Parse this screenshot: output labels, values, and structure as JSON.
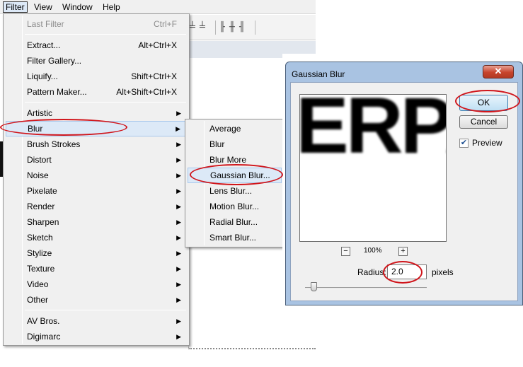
{
  "menubar": {
    "items": [
      "Filter",
      "View",
      "Window",
      "Help"
    ]
  },
  "filter_menu": {
    "last_filter": {
      "label": "Last Filter",
      "shortcut": "Ctrl+F"
    },
    "group1": [
      {
        "label": "Extract...",
        "shortcut": "Alt+Ctrl+X"
      },
      {
        "label": "Filter Gallery...",
        "shortcut": ""
      },
      {
        "label": "Liquify...",
        "shortcut": "Shift+Ctrl+X"
      },
      {
        "label": "Pattern Maker...",
        "shortcut": "Alt+Shift+Ctrl+X"
      }
    ],
    "group2": [
      "Artistic",
      "Blur",
      "Brush Strokes",
      "Distort",
      "Noise",
      "Pixelate",
      "Render",
      "Sharpen",
      "Sketch",
      "Stylize",
      "Texture",
      "Video",
      "Other"
    ],
    "group3": [
      "AV Bros.",
      "Digimarc"
    ],
    "highlighted": "Blur"
  },
  "blur_menu": {
    "items": [
      "Average",
      "Blur",
      "Blur More",
      "Gaussian Blur...",
      "Lens Blur...",
      "Motion Blur...",
      "Radial Blur...",
      "Smart Blur..."
    ],
    "highlighted": "Gaussian Blur..."
  },
  "dialog": {
    "title": "Gaussian Blur",
    "close_symbol": "✕",
    "preview_text": "ERPA",
    "zoom_level": "100%",
    "zoom_out": "−",
    "zoom_in": "+",
    "ok_label": "OK",
    "cancel_label": "Cancel",
    "preview_checked": true,
    "check_mark": "✔",
    "preview_label": "Preview",
    "radius_label": "Radius:",
    "radius_value": "2.0",
    "radius_unit": "pixels",
    "radius_slider_fraction": 0.07
  },
  "icons": {
    "submenu_arrow": "▶"
  },
  "colors": {
    "annotation": "#d0151b",
    "highlight": "#dce9f7"
  }
}
